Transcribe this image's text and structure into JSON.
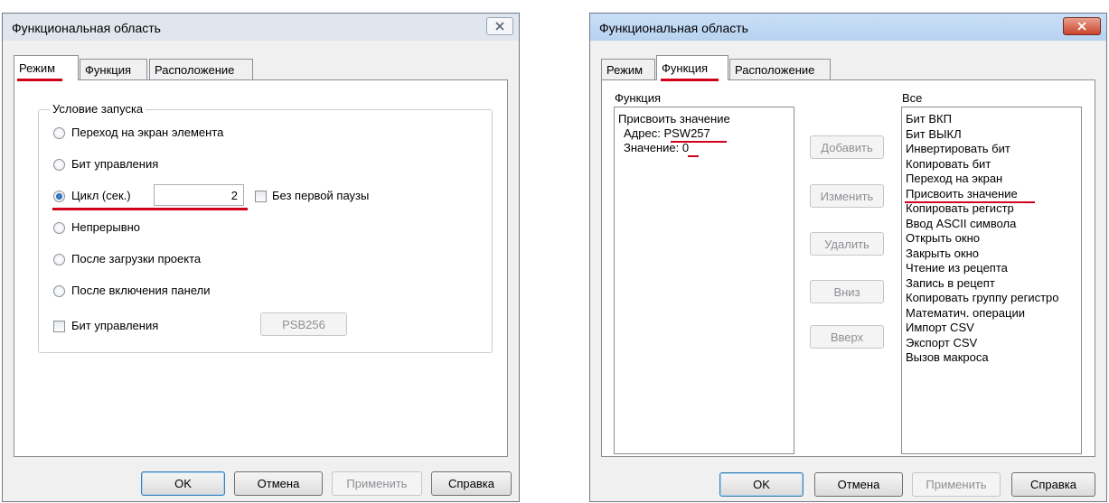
{
  "left": {
    "title": "Функциональная область",
    "tabs": [
      "Режим",
      "Функция",
      "Расположение"
    ],
    "group_label": "Условие запуска",
    "radios": [
      "Переход на экран элемента",
      "Бит управления",
      "Цикл (сек.)",
      "Непрерывно",
      "После загрузки проекта",
      "После включения панели"
    ],
    "selected_radio": "Цикл (сек.)",
    "cycle_value": "2",
    "no_first_pause_label": "Без первой паузы",
    "control_bit_label": "Бит управления",
    "control_bit_address": "PSB256"
  },
  "right": {
    "title": "Функциональная область",
    "tabs": [
      "Режим",
      "Функция",
      "Расположение"
    ],
    "function_label": "Функция",
    "function_name": "Присвоить значение",
    "address_label": "Адрес:",
    "address_value": "PSW257",
    "value_label": "Значение:",
    "value_value": "0",
    "buttons": [
      "Добавить",
      "Изменить",
      "Удалить",
      "Вниз",
      "Вверх"
    ],
    "all_label": "Все",
    "all_items": [
      "Бит ВКП",
      "Бит ВЫКЛ",
      "Инвертировать бит",
      "Копировать бит",
      "Переход на экран",
      "Присвоить значение",
      "Копировать регистр",
      "Ввод ASCII символа",
      "Открыть окно",
      "Закрыть окно",
      "Чтение из рецепта",
      "Запись в рецепт",
      "Копировать группу регистро",
      "Математич. операции",
      "Импорт CSV",
      "Экспорт CSV",
      "Вызов макроса"
    ]
  },
  "footer": {
    "ok": "OK",
    "cancel": "Отмена",
    "apply": "Применить",
    "help": "Справка"
  },
  "colors": {
    "highlight": "#d0021b"
  }
}
